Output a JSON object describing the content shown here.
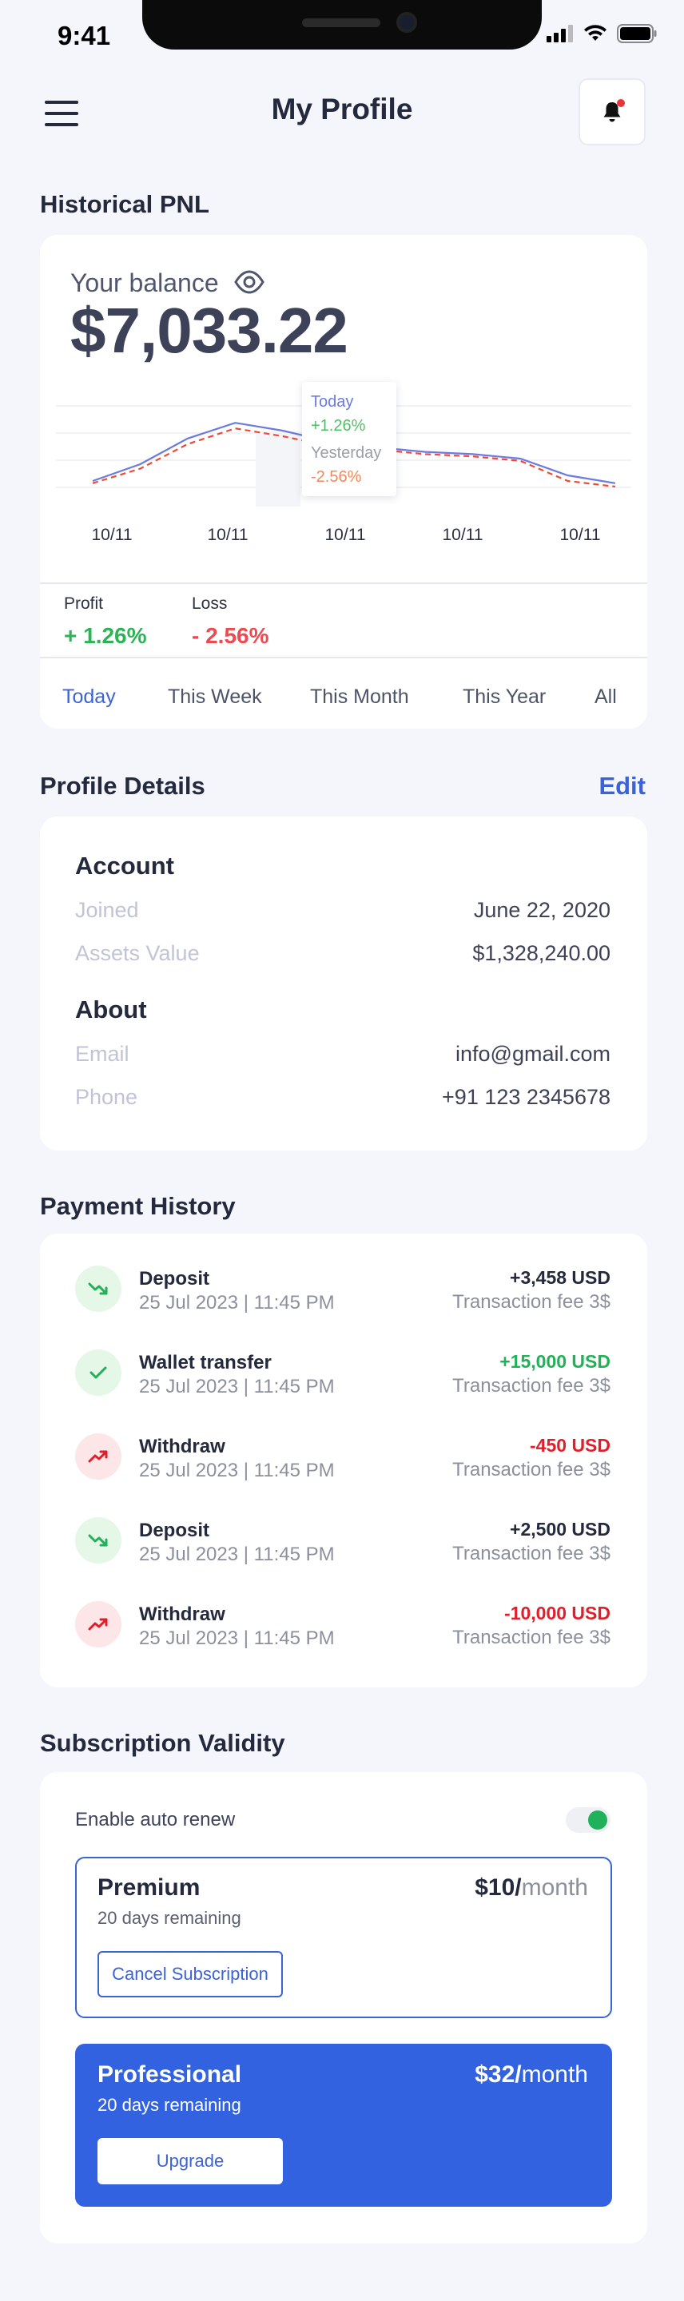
{
  "status_bar": {
    "time": "9:41"
  },
  "header": {
    "title": "My Profile"
  },
  "pnl": {
    "section_title": "Historical PNL",
    "balance_label": "Your balance",
    "balance_value": "$7,033.22",
    "tooltip": {
      "today_label": "Today",
      "today_value": "+1.26%",
      "yesterday_label": "Yesterday",
      "yesterday_value": "-2.56%"
    },
    "profit_label": "Profit",
    "profit_value": "+ 1.26%",
    "loss_label": "Loss",
    "loss_value": "- 2.56%",
    "ranges": [
      "Today",
      "This Week",
      "This Month",
      "This Year",
      "All"
    ],
    "active_range": "Today"
  },
  "chart_data": {
    "type": "line",
    "x": [
      "10/11",
      "10/11",
      "10/11",
      "10/11",
      "10/11"
    ],
    "series_style": {
      "today": "#6b7ae0",
      "yesterday": "#ee4a3a (dashed)"
    },
    "series": [
      {
        "values": [
          0.2,
          0.35,
          0.58,
          0.72,
          0.65,
          0.55,
          0.5,
          0.46,
          0.44,
          0.4,
          0.25,
          0.18
        ]
      },
      {
        "values": [
          0.18,
          0.31,
          0.53,
          0.67,
          0.6,
          0.51,
          0.48,
          0.44,
          0.42,
          0.38,
          0.2,
          0.15
        ]
      }
    ]
  },
  "profile": {
    "section_title": "Profile Details",
    "edit_label": "Edit",
    "account_heading": "Account",
    "joined_label": "Joined",
    "joined_value": "June 22, 2020",
    "assets_label": "Assets Value",
    "assets_value": "$1,328,240.00",
    "about_heading": "About",
    "email_label": "Email",
    "email_value": "info@gmail.com",
    "phone_label": "Phone",
    "phone_value": "+91 123 2345678"
  },
  "payments": {
    "section_title": "Payment History",
    "items": [
      {
        "title": "Deposit",
        "date": "25 Jul 2023 | 11:45 PM",
        "amount": "+3,458 USD",
        "fee": "Transaction fee 3$",
        "tone": "dark",
        "icon": "trend-down-icon"
      },
      {
        "title": "Wallet transfer",
        "date": "25 Jul 2023 | 11:45 PM",
        "amount": "+15,000 USD",
        "fee": "Transaction fee 3$",
        "tone": "green",
        "icon": "check-icon"
      },
      {
        "title": "Withdraw",
        "date": "25 Jul 2023 | 11:45 PM",
        "amount": "-450 USD",
        "fee": "Transaction fee 3$",
        "tone": "red",
        "icon": "trend-up-icon"
      },
      {
        "title": "Deposit",
        "date": "25 Jul 2023 | 11:45 PM",
        "amount": "+2,500 USD",
        "fee": "Transaction fee 3$",
        "tone": "dark",
        "icon": "trend-down-icon"
      },
      {
        "title": "Withdraw",
        "date": "25 Jul 2023 | 11:45 PM",
        "amount": "-10,000 USD",
        "fee": "Transaction fee 3$",
        "tone": "red",
        "icon": "trend-up-icon"
      }
    ]
  },
  "subscription": {
    "section_title": "Subscription Validity",
    "auto_renew_label": "Enable auto renew",
    "auto_renew_on": true,
    "premium": {
      "name": "Premium",
      "remaining": "20 days remaining",
      "price": "$10/",
      "per": "month",
      "button": "Cancel Subscription"
    },
    "professional": {
      "name": "Professional",
      "remaining": "20 days remaining",
      "price": "$32/",
      "per": "month",
      "button": "Upgrade"
    }
  },
  "colors": {
    "accent": "#3b63d6",
    "profit": "#2cb356",
    "loss": "#ee4a52",
    "toggle_on": "#1fb25a"
  }
}
